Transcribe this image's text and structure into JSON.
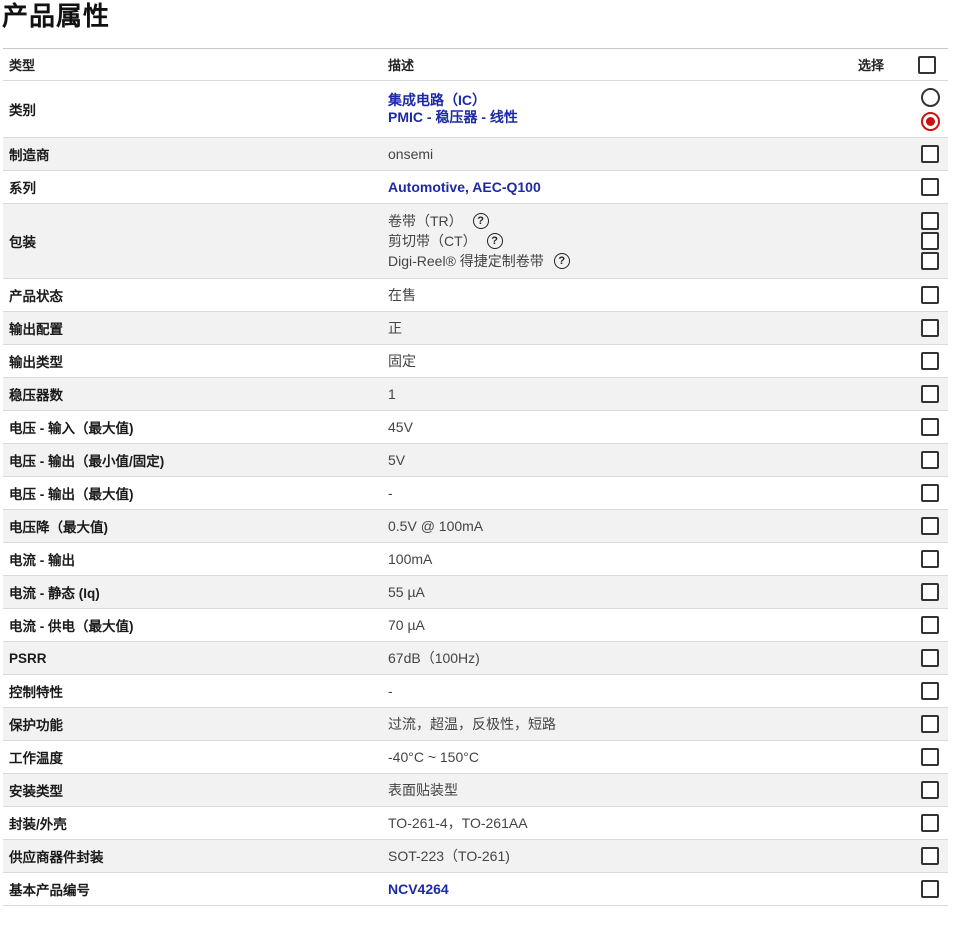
{
  "page_title": "产品属性",
  "header": {
    "type": "类型",
    "description": "描述",
    "select": "选择"
  },
  "rows": [
    {
      "name": "类别",
      "values": [
        "集成电路（IC）",
        "PMIC - 稳压器 - 线性"
      ]
    },
    {
      "name": "制造商",
      "value": "onsemi"
    },
    {
      "name": "系列",
      "value": "Automotive, AEC-Q100"
    },
    {
      "name": "包装",
      "values": [
        "卷带（TR）",
        "剪切带（CT）",
        "Digi-Reel® 得捷定制卷带"
      ]
    },
    {
      "name": "产品状态",
      "value": "在售"
    },
    {
      "name": "输出配置",
      "value": "正"
    },
    {
      "name": "输出类型",
      "value": "固定"
    },
    {
      "name": "稳压器数",
      "value": "1"
    },
    {
      "name": "电压 - 输入（最大值)",
      "value": "45V"
    },
    {
      "name": "电压 - 输出（最小值/固定)",
      "value": "5V"
    },
    {
      "name": "电压 - 输出（最大值)",
      "value": "-"
    },
    {
      "name": "电压降（最大值)",
      "value": "0.5V @ 100mA"
    },
    {
      "name": "电流 - 输出",
      "value": "100mA"
    },
    {
      "name": "电流 - 静态 (Iq)",
      "value": "55 µA"
    },
    {
      "name": "电流 - 供电（最大值)",
      "value": "70 µA"
    },
    {
      "name": "PSRR",
      "value": "67dB（100Hz)"
    },
    {
      "name": "控制特性",
      "value": "-"
    },
    {
      "name": "保护功能",
      "value": "过流，超温，反极性，短路"
    },
    {
      "name": "工作温度",
      "value": "-40°C ~ 150°C"
    },
    {
      "name": "安装类型",
      "value": "表面贴装型"
    },
    {
      "name": "封装/外壳",
      "value": "TO-261-4，TO-261AA"
    },
    {
      "name": "供应商器件封装",
      "value": "SOT-223（TO-261)"
    },
    {
      "name": "基本产品编号",
      "value": "NCV4264"
    }
  ],
  "category_selection": "PMIC - 稳压器 - 线性",
  "help_icon": "question-circle-icon",
  "accent_color": "#cc1111",
  "link_color": "#1c2aa6"
}
